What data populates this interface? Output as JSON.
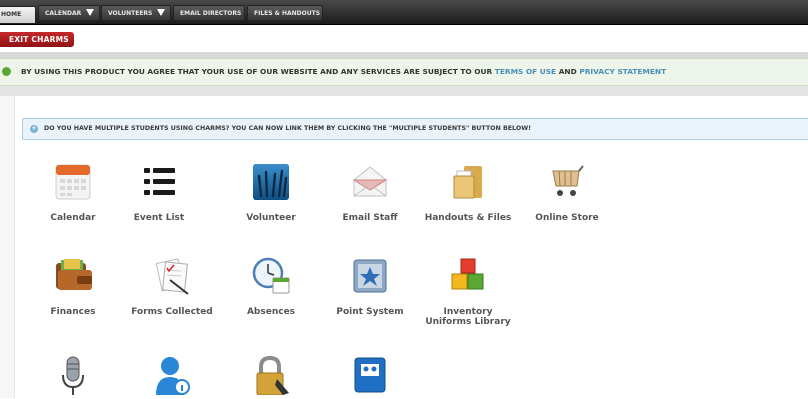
{
  "nav": {
    "tabs": [
      {
        "label": "HOME"
      },
      {
        "label": "CALENDAR"
      },
      {
        "label": "VOLUNTEERS"
      },
      {
        "label": "EMAIL DIRECTORS"
      },
      {
        "label": "FILES & HANDOUTS"
      }
    ]
  },
  "exit_label": "EXIT CHARMS",
  "agreement": {
    "text": "BY USING THIS PRODUCT YOU AGREE THAT YOUR USE OF OUR WEBSITE AND ANY SERVICES ARE SUBJECT TO OUR",
    "terms": "TERMS OF USE",
    "and": "AND",
    "privacy": "PRIVACY STATEMENT"
  },
  "notice": "DO YOU HAVE MULTIPLE STUDENTS USING CHARMS? YOU CAN NOW LINK THEM BY CLICKING THE \"MULTIPLE STUDENTS\" BUTTON BELOW!",
  "grid": {
    "row1": [
      {
        "label": "Calendar",
        "icon": "calendar-icon"
      },
      {
        "label": "Event List",
        "icon": "list-icon"
      },
      {
        "label": "Volunteer",
        "icon": "volunteer-hands-icon"
      },
      {
        "label": "Email Staff",
        "icon": "envelope-icon"
      },
      {
        "label": "Handouts & Files",
        "icon": "folder-icon"
      },
      {
        "label": "Online Store",
        "icon": "shopping-cart-icon"
      }
    ],
    "row2": [
      {
        "label": "Finances",
        "icon": "wallet-icon"
      },
      {
        "label": "Forms Collected",
        "icon": "forms-icon"
      },
      {
        "label": "Absences",
        "icon": "clock-calendar-icon"
      },
      {
        "label": "Point System",
        "icon": "star-book-icon"
      },
      {
        "label": "Inventory",
        "label2": "Uniforms Library",
        "icon": "blocks-icon"
      }
    ],
    "row3": [
      {
        "icon": "microphone-icon"
      },
      {
        "icon": "user-info-icon"
      },
      {
        "icon": "padlock-icon"
      },
      {
        "icon": "address-book-icon"
      }
    ]
  }
}
